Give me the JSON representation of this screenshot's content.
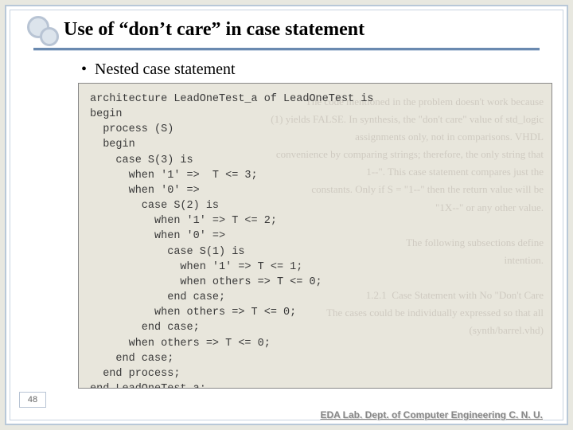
{
  "title": "Use of “don’t care” in case statement",
  "bullet": "Nested case statement",
  "code_lines": [
    "architecture LeadOneTest_a of LeadOneTest is",
    "begin",
    "  process (S)",
    "  begin",
    "    case S(3) is",
    "      when '1' =>  T <= 3;",
    "      when '0' =>",
    "        case S(2) is",
    "          when '1' => T <= 2;",
    "          when '0' =>",
    "            case S(1) is",
    "              when '1' => T <= 1;",
    "              when others => T <= 0;",
    "            end case;",
    "          when others => T <= 0;",
    "        end case;",
    "      when others => T <= 0;",
    "    end case;",
    "  end process;",
    "end LeadOneTest_a;"
  ],
  "page_number": "48",
  "footer": "EDA Lab. Dept. of Computer Engineering C. N. U."
}
